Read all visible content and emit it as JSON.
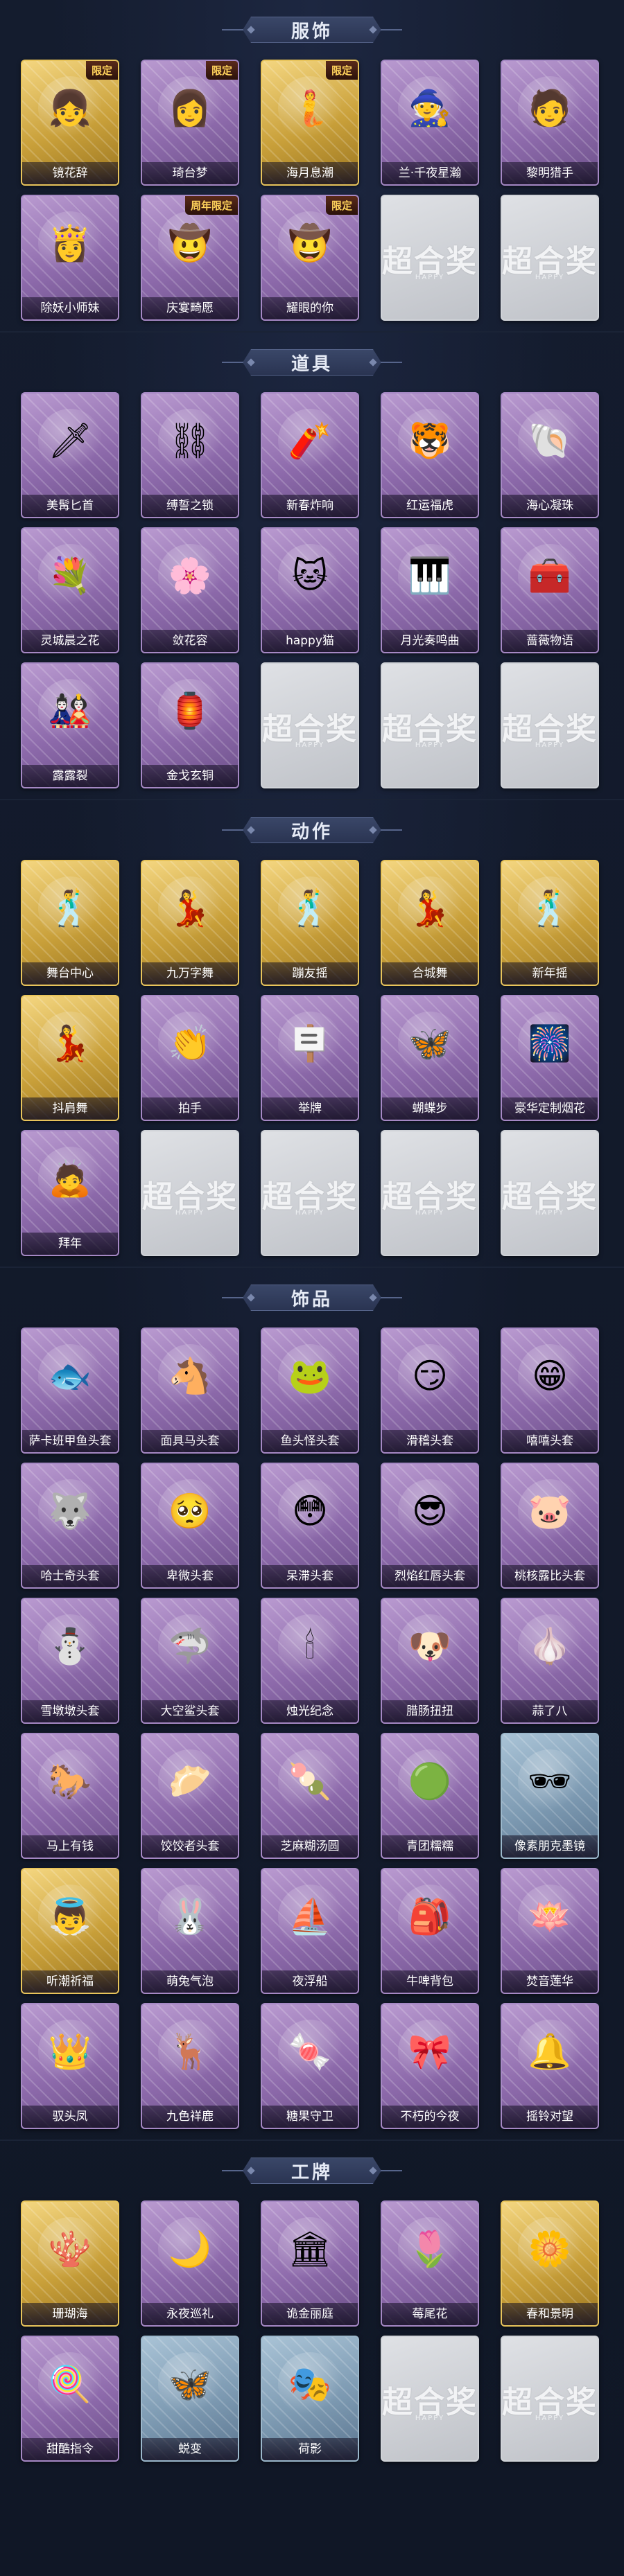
{
  "colors": {
    "background": "#121a2b",
    "banner": "#2f3a58",
    "label_text": "#ffffff",
    "limited_badge": "#ffd35c"
  },
  "placeholder": {
    "watermark": "超合奖",
    "sub": "HAPPY"
  },
  "sections": [
    {
      "title": "服饰",
      "items": [
        {
          "label": "镜花辞",
          "rarity": "gold",
          "badge": "限定",
          "icon": "red-hood-portrait-icon",
          "glyph": "👧"
        },
        {
          "label": "琦台梦",
          "rarity": "purple",
          "badge": "限定",
          "icon": "white-hair-portrait-icon",
          "glyph": "👩"
        },
        {
          "label": "海月息潮",
          "rarity": "gold",
          "badge": "限定",
          "icon": "teal-hair-portrait-icon",
          "glyph": "🧜"
        },
        {
          "label": "兰·千夜星瀚",
          "rarity": "purple",
          "badge": "",
          "icon": "witch-hat-portrait-icon",
          "glyph": "🧙"
        },
        {
          "label": "黎明猎手",
          "rarity": "purple",
          "badge": "",
          "icon": "hunter-portrait-icon",
          "glyph": "🧑"
        },
        {
          "label": "除妖小师妹",
          "rarity": "purple",
          "badge": "",
          "icon": "white-robe-portrait-icon",
          "glyph": "👸"
        },
        {
          "label": "庆宴畸愿",
          "rarity": "purple",
          "badge": "周年限定",
          "icon": "festival-portrait-icon",
          "glyph": "🤠"
        },
        {
          "label": "耀眼的你",
          "rarity": "purple",
          "badge": "限定",
          "icon": "cowboy-hat-portrait-icon",
          "glyph": "🤠"
        }
      ]
    },
    {
      "title": "道具",
      "items": [
        {
          "label": "美髯匕首",
          "rarity": "purple",
          "icon": "dagger-icon",
          "glyph": "🗡"
        },
        {
          "label": "缚誓之锁",
          "rarity": "purple",
          "icon": "chain-icon",
          "glyph": "⛓"
        },
        {
          "label": "新春炸响",
          "rarity": "purple",
          "icon": "firecracker-icon",
          "glyph": "🧨"
        },
        {
          "label": "红运福虎",
          "rarity": "purple",
          "icon": "tiger-icon",
          "glyph": "🐯"
        },
        {
          "label": "海心凝珠",
          "rarity": "purple",
          "icon": "pearl-shell-icon",
          "glyph": "🐚"
        },
        {
          "label": "灵城晨之花",
          "rarity": "purple",
          "icon": "bouquet-icon",
          "glyph": "💐"
        },
        {
          "label": "敛花容",
          "rarity": "purple",
          "icon": "hairpin-icon",
          "glyph": "🌸"
        },
        {
          "label": "happy猫",
          "rarity": "purple",
          "icon": "cat-icon",
          "glyph": "🐱"
        },
        {
          "label": "月光奏鸣曲",
          "rarity": "purple",
          "icon": "piano-icon",
          "glyph": "🎹"
        },
        {
          "label": "蔷薇物语",
          "rarity": "purple",
          "icon": "medkit-icon",
          "glyph": "🧰"
        },
        {
          "label": "露露裂",
          "rarity": "purple",
          "icon": "doll-icon",
          "glyph": "🎎"
        },
        {
          "label": "金戈玄铜",
          "rarity": "purple",
          "icon": "bronze-lantern-icon",
          "glyph": "🏮"
        }
      ]
    },
    {
      "title": "动作",
      "items": [
        {
          "label": "舞台中心",
          "rarity": "gold",
          "icon": "dance-pose-icon",
          "glyph": "🕺"
        },
        {
          "label": "九万字舞",
          "rarity": "gold",
          "icon": "dance-pose-icon",
          "glyph": "💃"
        },
        {
          "label": "蹦友摇",
          "rarity": "gold",
          "icon": "dance-pose-icon",
          "glyph": "🕺"
        },
        {
          "label": "合城舞",
          "rarity": "gold",
          "icon": "dance-pose-icon",
          "glyph": "💃"
        },
        {
          "label": "新年摇",
          "rarity": "gold",
          "icon": "dance-pose-icon",
          "glyph": "🕺"
        },
        {
          "label": "抖肩舞",
          "rarity": "gold",
          "icon": "dance-pose-icon",
          "glyph": "💃"
        },
        {
          "label": "拍手",
          "rarity": "purple",
          "icon": "clap-pose-icon",
          "glyph": "👏"
        },
        {
          "label": "举牌",
          "rarity": "purple",
          "icon": "sign-pose-icon",
          "glyph": "🪧"
        },
        {
          "label": "蝴蝶步",
          "rarity": "purple",
          "icon": "step-pose-icon",
          "glyph": "🦋"
        },
        {
          "label": "豪华定制烟花",
          "rarity": "purple",
          "icon": "firework-icon",
          "glyph": "🎆"
        },
        {
          "label": "拜年",
          "rarity": "purple",
          "icon": "bow-pose-icon",
          "glyph": "🙇"
        }
      ]
    },
    {
      "title": "饰品",
      "items": [
        {
          "label": "萨卡班甲鱼头套",
          "rarity": "purple",
          "icon": "fish-head-icon",
          "glyph": "🐟"
        },
        {
          "label": "面具马头套",
          "rarity": "purple",
          "icon": "horse-head-icon",
          "glyph": "🐴"
        },
        {
          "label": "鱼头怪头套",
          "rarity": "purple",
          "icon": "fish-monster-icon",
          "glyph": "🐸"
        },
        {
          "label": "滑稽头套",
          "rarity": "purple",
          "icon": "funny-face-icon",
          "glyph": "😏"
        },
        {
          "label": "嘻嘻头套",
          "rarity": "purple",
          "icon": "grin-face-icon",
          "glyph": "😁"
        },
        {
          "label": "哈士奇头套",
          "rarity": "purple",
          "icon": "husky-icon",
          "glyph": "🐺"
        },
        {
          "label": "卑微头套",
          "rarity": "purple",
          "icon": "sad-face-icon",
          "glyph": "🥺"
        },
        {
          "label": "呆滞头套",
          "rarity": "purple",
          "icon": "dazed-face-icon",
          "glyph": "😳"
        },
        {
          "label": "烈焰红唇头套",
          "rarity": "purple",
          "icon": "pikachu-icon",
          "glyph": "😎"
        },
        {
          "label": "桃核露比头套",
          "rarity": "purple",
          "icon": "pink-creature-icon",
          "glyph": "🐷"
        },
        {
          "label": "雪墩墩头套",
          "rarity": "purple",
          "icon": "snow-creature-icon",
          "glyph": "⛄"
        },
        {
          "label": "大空鲨头套",
          "rarity": "purple",
          "icon": "shark-icon",
          "glyph": "🦈"
        },
        {
          "label": "烛光纪念",
          "rarity": "purple",
          "icon": "candle-icon",
          "glyph": "🕯"
        },
        {
          "label": "腊肠扭扭",
          "rarity": "purple",
          "icon": "dachshund-icon",
          "glyph": "🐶"
        },
        {
          "label": "蒜了八",
          "rarity": "purple",
          "icon": "garlic-icon",
          "glyph": "🧄"
        },
        {
          "label": "马上有钱",
          "rarity": "purple",
          "icon": "red-horse-icon",
          "glyph": "🐎"
        },
        {
          "label": "饺饺者头套",
          "rarity": "purple",
          "icon": "dumpling-icon",
          "glyph": "🥟"
        },
        {
          "label": "芝麻糊汤圆",
          "rarity": "purple",
          "icon": "rice-ball-icon",
          "glyph": "🍡"
        },
        {
          "label": "青团糯糯",
          "rarity": "purple",
          "icon": "green-ball-icon",
          "glyph": "🟢"
        },
        {
          "label": "像素朋克墨镜",
          "rarity": "blue",
          "icon": "pixel-sunglasses-icon",
          "glyph": "🕶"
        },
        {
          "label": "听潮祈福",
          "rarity": "gold",
          "icon": "angel-wings-icon",
          "glyph": "👼"
        },
        {
          "label": "萌兔气泡",
          "rarity": "purple",
          "icon": "rabbit-bubble-icon",
          "glyph": "🐰"
        },
        {
          "label": "夜浮船",
          "rarity": "purple",
          "icon": "lantern-boat-icon",
          "glyph": "⛵"
        },
        {
          "label": "牛啤背包",
          "rarity": "purple",
          "icon": "backpack-icon",
          "glyph": "🎒"
        },
        {
          "label": "焚音莲华",
          "rarity": "purple",
          "icon": "lotus-icon",
          "glyph": "🪷"
        },
        {
          "label": "驭头凤",
          "rarity": "purple",
          "icon": "phoenix-crown-icon",
          "glyph": "👑"
        },
        {
          "label": "九色祥鹿",
          "rarity": "purple",
          "icon": "deer-icon",
          "glyph": "🦌"
        },
        {
          "label": "糖果守卫",
          "rarity": "purple",
          "icon": "candy-guard-icon",
          "glyph": "🍬"
        },
        {
          "label": "不朽的今夜",
          "rarity": "purple",
          "icon": "pink-charm-icon",
          "glyph": "🎀"
        },
        {
          "label": "摇铃对望",
          "rarity": "purple",
          "icon": "bell-charm-icon",
          "glyph": "🔔"
        }
      ]
    },
    {
      "title": "工牌",
      "items": [
        {
          "label": "珊瑚海",
          "rarity": "gold",
          "icon": "coral-badge-icon",
          "glyph": "🪸"
        },
        {
          "label": "永夜巡礼",
          "rarity": "purple",
          "icon": "night-badge-icon",
          "glyph": "🌙"
        },
        {
          "label": "诡金丽庭",
          "rarity": "purple",
          "icon": "gold-badge-icon",
          "glyph": "🏛"
        },
        {
          "label": "莓尾花",
          "rarity": "purple",
          "icon": "lilac-badge-icon",
          "glyph": "🌷"
        },
        {
          "label": "春和景明",
          "rarity": "gold",
          "icon": "spring-badge-icon",
          "glyph": "🌼"
        },
        {
          "label": "甜酷指令",
          "rarity": "purple",
          "icon": "sweet-badge-icon",
          "glyph": "🍭"
        },
        {
          "label": "蜕变",
          "rarity": "blue",
          "icon": "butterfly-badge-icon",
          "glyph": "🦋"
        },
        {
          "label": "荷影",
          "rarity": "blue",
          "icon": "shadow-badge-icon",
          "glyph": "🎭"
        }
      ]
    }
  ]
}
